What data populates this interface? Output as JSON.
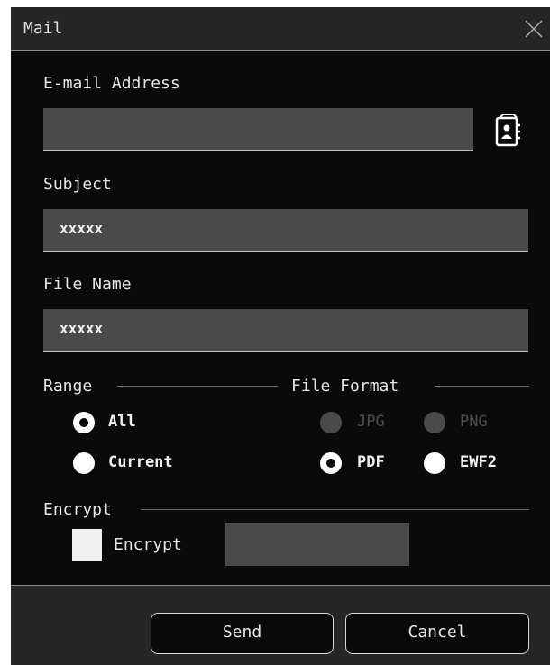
{
  "window": {
    "title": "Mail"
  },
  "email": {
    "label": "E-mail Address",
    "value": ""
  },
  "subject": {
    "label": "Subject",
    "value": "xxxxx"
  },
  "file_name": {
    "label": "File Name",
    "value": "xxxxx"
  },
  "range": {
    "label": "Range",
    "options": [
      {
        "label": "All",
        "selected": true
      },
      {
        "label": "Current",
        "selected": false
      }
    ]
  },
  "file_format": {
    "label": "File Format",
    "options": [
      {
        "label": "JPG",
        "selected": false,
        "enabled": false
      },
      {
        "label": "PNG",
        "selected": false,
        "enabled": false
      },
      {
        "label": "PDF",
        "selected": true,
        "enabled": true
      },
      {
        "label": "EWF2",
        "selected": false,
        "enabled": true
      }
    ]
  },
  "encrypt": {
    "section_label": "Encrypt",
    "checkbox_label": "Encrypt",
    "checked": false,
    "password": ""
  },
  "buttons": {
    "send": "Send",
    "cancel": "Cancel"
  },
  "icons": {
    "close": "close-icon",
    "address_book": "address-book-icon"
  },
  "colors": {
    "background": "#0a0a0a",
    "field": "#4a4a4a",
    "bar": "#262626",
    "text": "#e8e8e8"
  }
}
